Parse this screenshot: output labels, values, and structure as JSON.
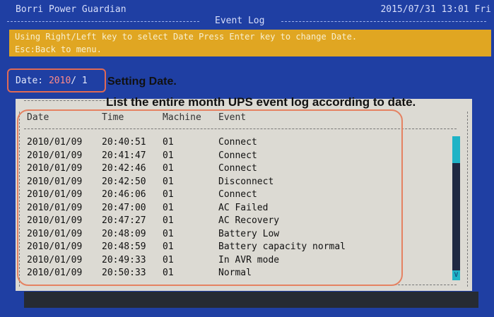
{
  "header": {
    "app_title": "Borri Power Guardian",
    "datetime": "2015/07/31 13:01 Fri",
    "screen_title": "Event Log"
  },
  "instructions": {
    "line1": "Using Right/Left key to select Date Press Enter key to change Date.",
    "line2": "Esc:Back to menu."
  },
  "date_selector": {
    "label": "Date:",
    "year": "2010",
    "month": "/ 1"
  },
  "callouts": {
    "setting_date": "Setting Date.",
    "list_month": "List the entire month UPS event log according to date."
  },
  "log": {
    "columns": [
      "Date",
      "Time",
      "Machine",
      "Event"
    ],
    "rows": [
      [
        "2010/01/09",
        "20:40:51",
        "01",
        "Connect"
      ],
      [
        "2010/01/09",
        "20:41:47",
        "01",
        "Connect"
      ],
      [
        "2010/01/09",
        "20:42:46",
        "01",
        "Connect"
      ],
      [
        "2010/01/09",
        "20:42:50",
        "01",
        "Disconnect"
      ],
      [
        "2010/01/09",
        "20:46:06",
        "01",
        "Connect"
      ],
      [
        "2010/01/09",
        "20:47:00",
        "01",
        "AC Failed"
      ],
      [
        "2010/01/09",
        "20:47:27",
        "01",
        "AC Recovery"
      ],
      [
        "2010/01/09",
        "20:48:09",
        "01",
        "Battery Low"
      ],
      [
        "2010/01/09",
        "20:48:59",
        "01",
        "Battery capacity normal"
      ],
      [
        "2010/01/09",
        "20:49:33",
        "01",
        "In AVR mode"
      ],
      [
        "2010/01/09",
        "20:50:33",
        "01",
        "Normal"
      ]
    ],
    "scroll_arrow": "V"
  },
  "colors": {
    "background": "#1f3fa3",
    "instruction_bar": "#e0a622",
    "log_panel": "#dcdad3",
    "highlight": "#e58262",
    "scroll_thumb": "#1fb3c6"
  }
}
